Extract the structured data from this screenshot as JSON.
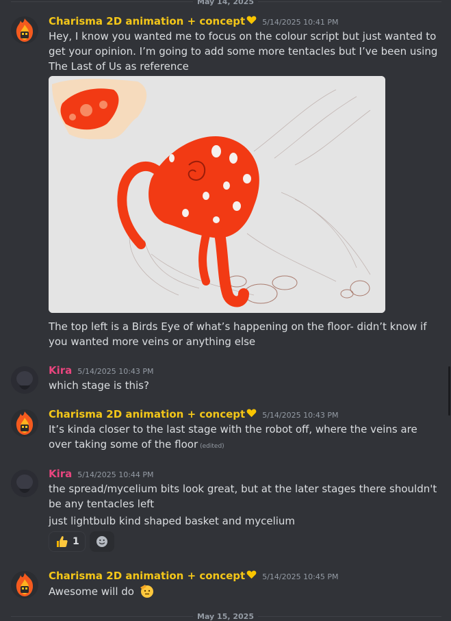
{
  "dividers": {
    "top": "May 14, 2025",
    "bottom": "May 15, 2025"
  },
  "messages": [
    {
      "author": "Charisma 2D animation + concept",
      "timestamp": "5/14/2025 10:41 PM",
      "text": "Hey, I know you wanted me to focus on the colour script but just wanted to get your opinion. I’m going to add some more tentacles but I’ve been using The Last of Us as reference",
      "caption": "The top left is a Birds Eye of what’s happening on the floor- didn’t know if you wanted more veins or anything else"
    },
    {
      "author": "Kira",
      "timestamp": "5/14/2025 10:43 PM",
      "text": "which stage is this?"
    },
    {
      "author": "Charisma 2D animation + concept",
      "timestamp": "5/14/2025 10:43 PM",
      "text": "It’s kinda closer to the last stage with the robot off, where the veins are over taking some of the floor",
      "edited": "(edited)"
    },
    {
      "author": "Kira",
      "timestamp": "5/14/2025 10:44 PM",
      "text": "the spread/mycelium bits look great, but at the later stages there shouldn't be any tentacles left",
      "text2": "just lightbulb kind shaped basket and mycelium",
      "reactions": [
        {
          "emoji": "thumbs-up-icon",
          "count": "1"
        },
        {
          "emoji": "add-reaction-icon"
        }
      ]
    },
    {
      "author": "Charisma 2D animation + concept",
      "timestamp": "5/14/2025 10:45 PM",
      "text": "Awesome will do"
    }
  ],
  "colors": {
    "background": "#313338",
    "charisma_name": "#f3c619",
    "kira_name": "#e8457e",
    "text": "#dbdee1",
    "timestamp": "#949ba4",
    "artwork_red": "#f23a14"
  }
}
